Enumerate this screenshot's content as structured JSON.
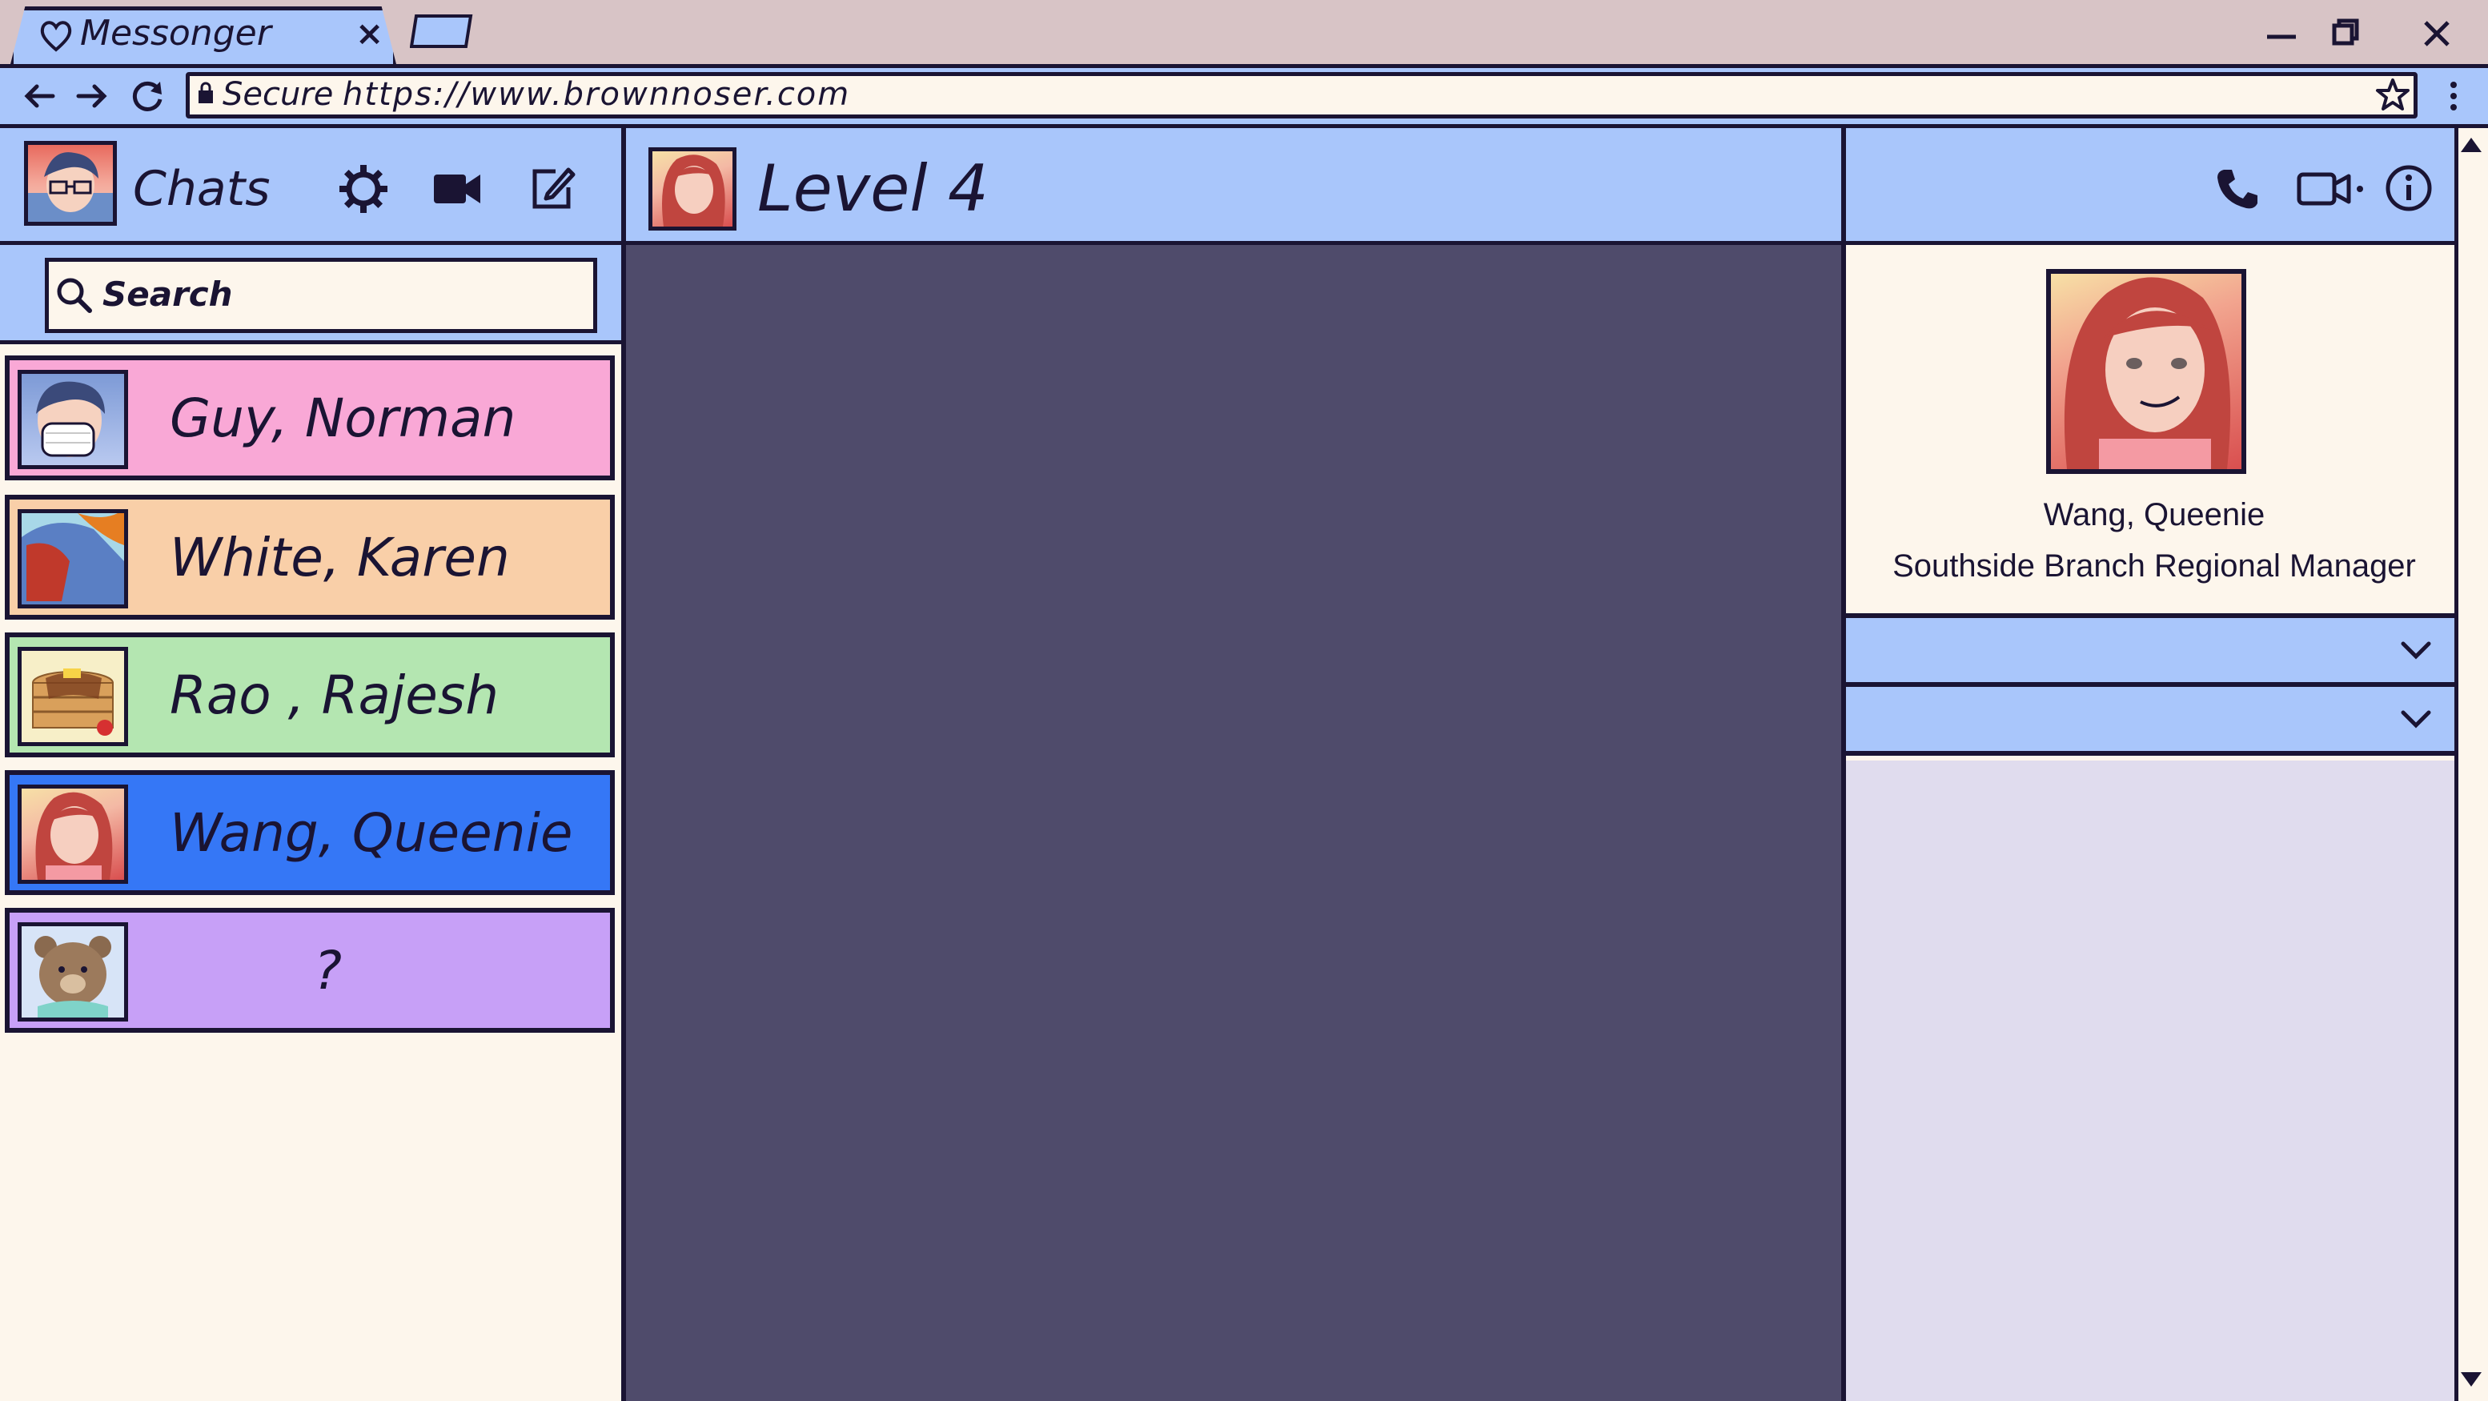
{
  "browser": {
    "tab_title": "Messonger",
    "tab_close": "×",
    "secure_label": "Secure",
    "url": "https://www.brownnoser.com"
  },
  "left_panel": {
    "title": "Chats",
    "search_placeholder": "Search"
  },
  "contacts": [
    {
      "name": "Guy, Norman",
      "color": "#f9a8d6"
    },
    {
      "name": "White, Karen",
      "color": "#f9cfa8"
    },
    {
      "name": "Rao , Rajesh",
      "color": "#b4e6b1"
    },
    {
      "name": "Wang, Queenie",
      "color": "#3577f6",
      "selected": true
    },
    {
      "name": "?",
      "color": "#c7a0f7"
    }
  ],
  "chat": {
    "title": "Level 4"
  },
  "profile": {
    "name": "Wang, Queenie",
    "role": "Southside Branch Regional Manager"
  },
  "colors": {
    "panel_blue": "#a9c6fb",
    "chat_bg": "#4f4b6b",
    "cream": "#fdf6ec",
    "outline": "#1a1433"
  }
}
